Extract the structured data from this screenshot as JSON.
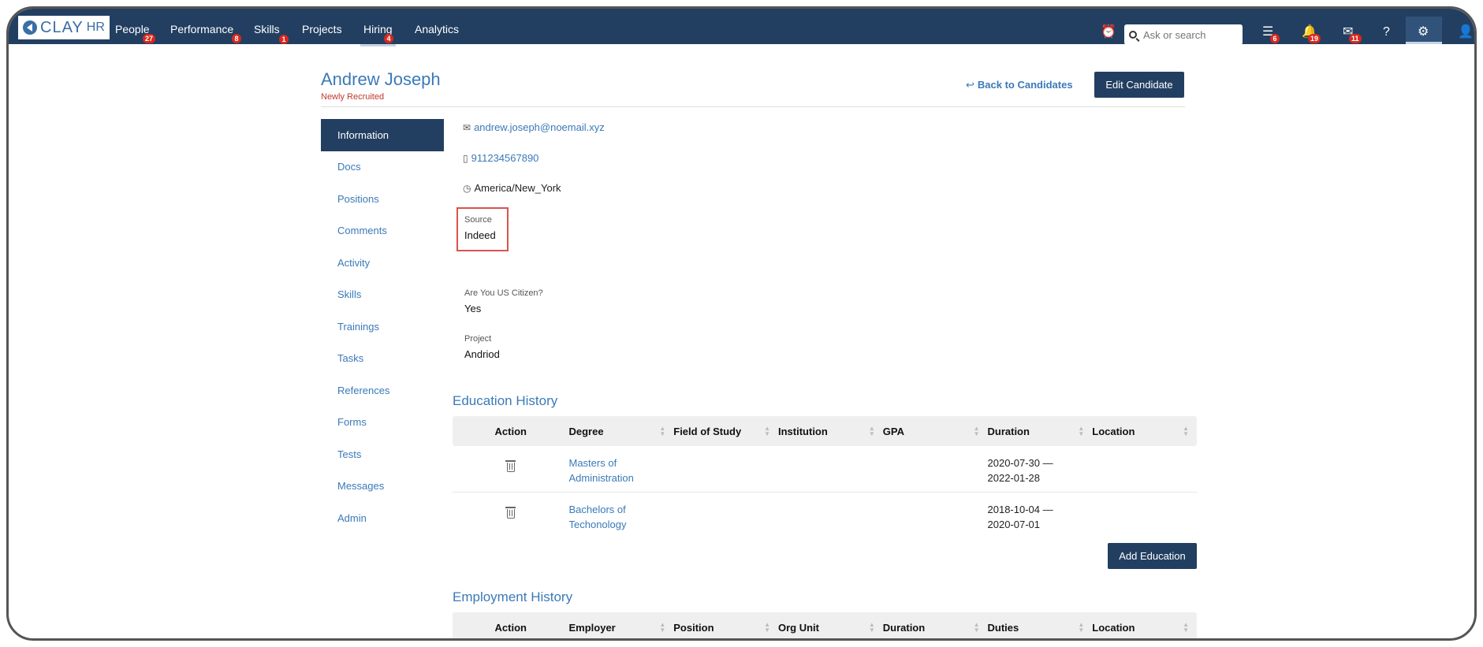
{
  "topnav": {
    "logo_text": "CLAY",
    "logo_suffix": "HR",
    "items": [
      {
        "label": "People",
        "badge": "27"
      },
      {
        "label": "Performance",
        "badge": "8"
      },
      {
        "label": "Skills",
        "badge": "1"
      },
      {
        "label": "Projects",
        "badge": ""
      },
      {
        "label": "Hiring",
        "badge": "4"
      },
      {
        "label": "Analytics",
        "badge": ""
      }
    ],
    "active_item": "Hiring",
    "search_placeholder": "Ask or search",
    "icon_badges": {
      "inbox": "6",
      "notifications": "19",
      "mail": "11"
    }
  },
  "candidate": {
    "name": "Andrew Joseph",
    "status": "Newly Recruited",
    "back_label": "Back to Candidates",
    "edit_label": "Edit Candidate"
  },
  "side_menu": [
    "Information",
    "Docs",
    "Positions",
    "Comments",
    "Activity",
    "Skills",
    "Trainings",
    "Tasks",
    "References",
    "Forms",
    "Tests",
    "Messages",
    "Admin"
  ],
  "info": {
    "email": "andrew.joseph@noemail.xyz",
    "phone": "911234567890",
    "timezone": "America/New_York",
    "source_label": "Source",
    "source_value": "Indeed",
    "citizen_label": "Are You US Citizen?",
    "citizen_value": "Yes",
    "project_label": "Project",
    "project_value": "Andriod"
  },
  "education": {
    "title": "Education History",
    "columns": [
      "Action",
      "Degree",
      "Field of Study",
      "Institution",
      "GPA",
      "Duration",
      "Location"
    ],
    "rows": [
      {
        "degree_l1": "Masters of",
        "degree_l2": "Administration",
        "duration_l1": "2020-07-30 —",
        "duration_l2": "2022-01-28"
      },
      {
        "degree_l1": "Bachelors of",
        "degree_l2": "Techonology",
        "duration_l1": "2018-10-04 —",
        "duration_l2": "2020-07-01"
      }
    ],
    "add_label": "Add Education"
  },
  "employment": {
    "title": "Employment History",
    "columns": [
      "Action",
      "Employer",
      "Position",
      "Org Unit",
      "Duration",
      "Duties",
      "Location"
    ]
  },
  "colors": {
    "nav_bg": "#223f61",
    "link": "#3a7ab8",
    "badge": "#d9281d",
    "status": "#c0392b"
  }
}
